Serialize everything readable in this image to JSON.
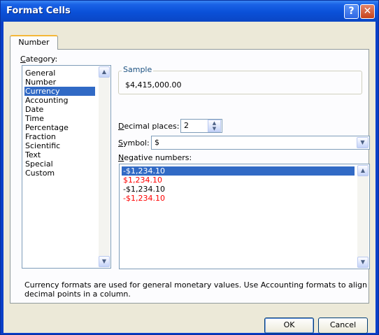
{
  "window": {
    "title": "Format Cells",
    "help_glyph": "?",
    "close_glyph": "✕"
  },
  "tabs": [
    {
      "label": "Number",
      "active": true
    }
  ],
  "category": {
    "label_first": "C",
    "label_rest": "ategory:",
    "items": [
      "General",
      "Number",
      "Currency",
      "Accounting",
      "Date",
      "Time",
      "Percentage",
      "Fraction",
      "Scientific",
      "Text",
      "Special",
      "Custom"
    ],
    "selected": "Currency"
  },
  "sample": {
    "legend": "Sample",
    "value": "$4,415,000.00"
  },
  "decimal_places": {
    "label_first": "D",
    "label_rest": "ecimal places:",
    "value": "2"
  },
  "symbol": {
    "label_first": "S",
    "label_rest": "ymbol:",
    "value": "$"
  },
  "negative_numbers": {
    "label_first": "N",
    "label_rest": "egative numbers:",
    "items": [
      {
        "text": "-$1,234.10",
        "color": "black",
        "selected": true
      },
      {
        "text": "$1,234.10",
        "color": "red",
        "selected": false
      },
      {
        "text": "-$1,234.10",
        "color": "black",
        "selected": false
      },
      {
        "text": "-$1,234.10",
        "color": "red",
        "selected": false
      }
    ]
  },
  "description": "Currency formats are used for general monetary values.  Use Accounting formats to align decimal points in a column.",
  "buttons": {
    "ok": "OK",
    "cancel": "Cancel"
  },
  "colors": {
    "title_bar": "#0a50d8",
    "selection": "#316ac5",
    "negative_red": "#ff0000",
    "dialog_face": "#ece9d8"
  }
}
